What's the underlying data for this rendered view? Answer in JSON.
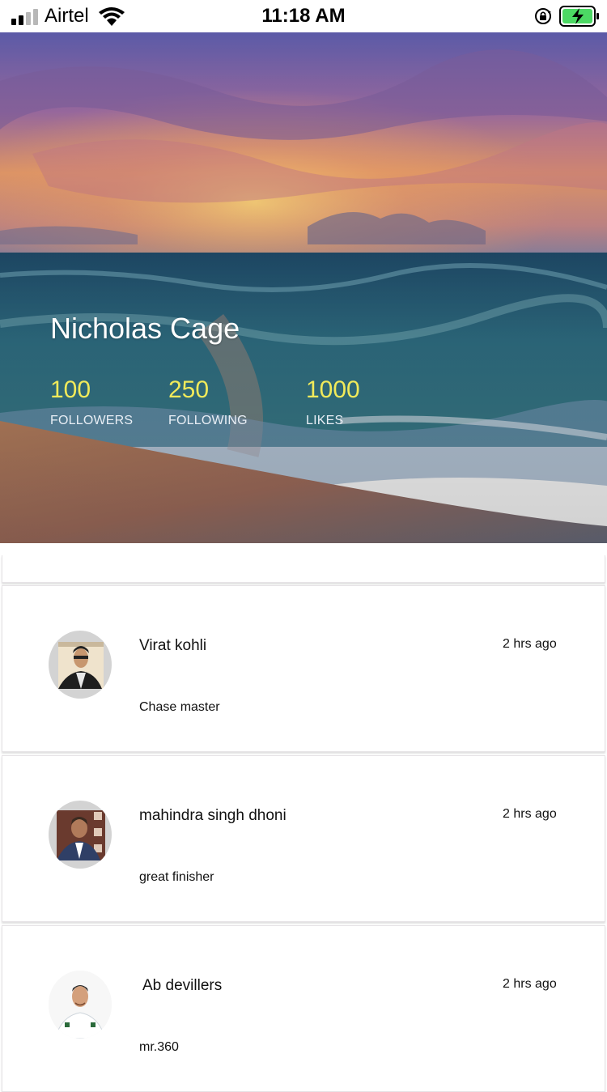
{
  "status_bar": {
    "carrier": "Airtel",
    "time": "11:18 AM",
    "icons": [
      "signal-icon",
      "wifi-icon",
      "rotation-lock-icon",
      "battery-charging-icon"
    ]
  },
  "profile": {
    "name": "Nicholas Cage",
    "stats": [
      {
        "value": "100",
        "label": "FOLLOWERS"
      },
      {
        "value": "250",
        "label": "FOLLOWING"
      },
      {
        "value": "1000",
        "label": "LIKES"
      }
    ]
  },
  "colors": {
    "stat_value": "#f1ea5a",
    "card_border": "#e6e3e6"
  },
  "feed": [
    {
      "name": "Virat kohli",
      "time": "2 hrs ago",
      "text": "Chase master"
    },
    {
      "name": "mahindra singh dhoni",
      "time": "2 hrs ago",
      "text": "great finisher"
    },
    {
      "name": "Ab devillers",
      "time": "2 hrs ago",
      "text": "mr.360"
    }
  ]
}
